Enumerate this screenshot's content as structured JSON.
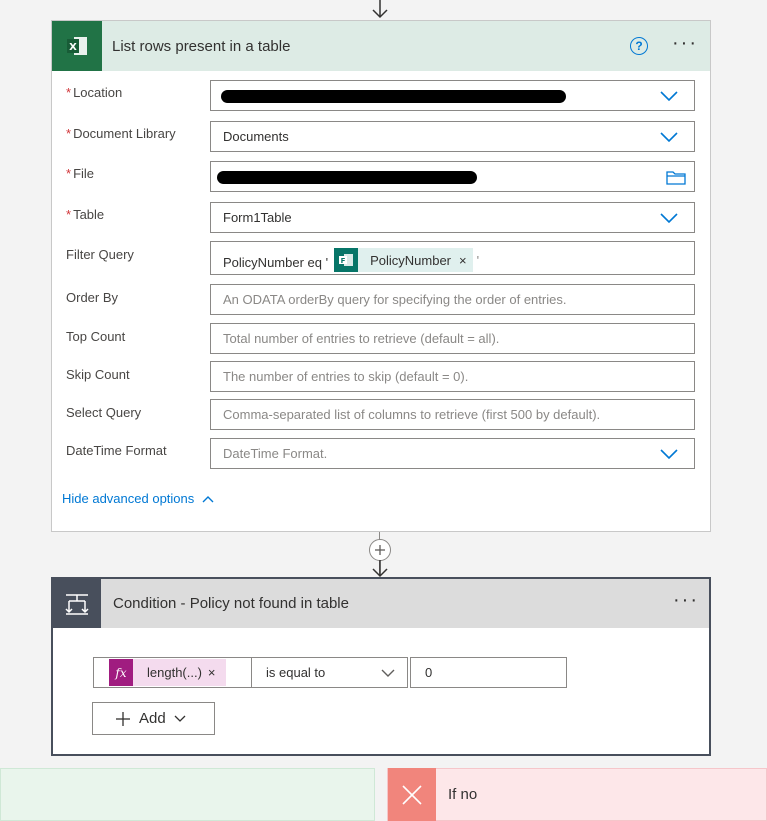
{
  "action": {
    "title": "List rows present in a table",
    "help_glyph": "?",
    "more_glyph": "···",
    "fields": {
      "location": {
        "label": "Location",
        "required": true
      },
      "document_library": {
        "label": "Document Library",
        "value": "Documents"
      },
      "file": {
        "label": "File"
      },
      "table": {
        "label": "Table",
        "value": "Form1Table"
      },
      "filter_query": {
        "label": "Filter Query",
        "prefix": "PolicyNumber eq '",
        "token": "PolicyNumber",
        "suffix": "'"
      },
      "order_by": {
        "label": "Order By",
        "placeholder": "An ODATA orderBy query for specifying the order of entries."
      },
      "top_count": {
        "label": "Top Count",
        "placeholder": "Total number of entries to retrieve (default = all)."
      },
      "skip_count": {
        "label": "Skip Count",
        "placeholder": "The number of entries to skip (default = 0)."
      },
      "select_query": {
        "label": "Select Query",
        "placeholder": "Comma-separated list of columns to retrieve (first 500 by default)."
      },
      "datetime_format": {
        "label": "DateTime Format",
        "placeholder": "DateTime Format."
      }
    },
    "hide_advanced": "Hide advanced options",
    "required_mark": "*",
    "token_remove": "×"
  },
  "condition": {
    "title": "Condition - Policy not found in table",
    "more_glyph": "···",
    "left_expression": "length(...)",
    "expression_remove": "×",
    "operator": "is equal to",
    "right_value": "0",
    "add_label": "Add"
  },
  "branches": {
    "no_label": "If no"
  },
  "colors": {
    "excel_green": "#217346",
    "condition_dark": "#484f5c",
    "link_blue": "#0078d4",
    "required_red": "#d13438",
    "no_branch_red": "#f1857c",
    "fx_purple": "#a01c80"
  }
}
